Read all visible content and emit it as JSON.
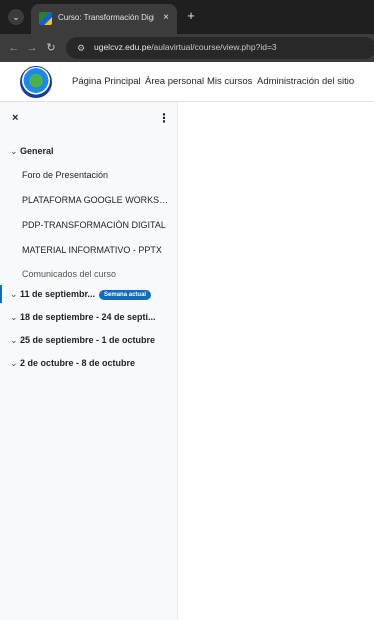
{
  "browser": {
    "tab_title": "Curso: Transformación Digital /",
    "tab_close": "×",
    "new_tab": "+",
    "url_host": "ugelcvz.edu.pe",
    "url_path": "/aulavirtual/course/view.php?id=3"
  },
  "navbar": {
    "links": [
      "Página Principal",
      "Área personal",
      "Mis cursos",
      "Administración del sitio"
    ]
  },
  "drawer": {
    "close": "×",
    "menu": "⋮",
    "general": "General",
    "activities": [
      "Foro de Presentación",
      "PLATAFORMA GOOGLE WORKSPACE",
      "PDP-TRANSFORMACIÓN DIGITAL",
      "MATERIAL INFORMATIVO - PPTX",
      "Comunicados del curso"
    ],
    "sections": [
      "11 de septiembr...",
      "18 de septiembre - 24 de septi...",
      "25 de septiembre - 1 de octubre",
      "2 de octubre - 8 de octubre"
    ],
    "current_badge": "Semana actual"
  },
  "colors": {
    "accent": "#0f6cbf",
    "chrome_dark": "#1f1f1f",
    "drawer_bg": "#f8f9fa"
  }
}
